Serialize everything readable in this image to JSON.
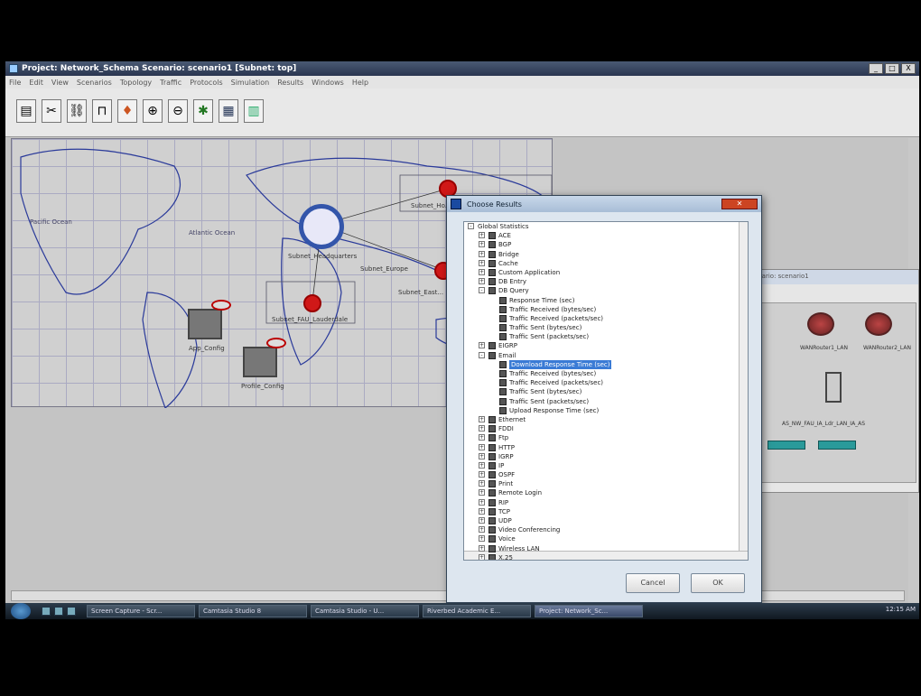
{
  "window": {
    "title": "Project: Network_Schema Scenario: scenario1 [Subnet: top]",
    "controls": [
      "_",
      "□",
      "X"
    ]
  },
  "menubar": [
    "File",
    "Edit",
    "View",
    "Scenarios",
    "Topology",
    "Traffic",
    "Protocols",
    "Simulation",
    "Results",
    "Windows",
    "Help"
  ],
  "toolbar": [
    "open-icon",
    "cut-tool-icon",
    "link-tool-icon",
    "subnet-tool-icon",
    "location-pin-icon",
    "zoom-in-icon",
    "zoom-out-icon",
    "configure-icon",
    "run-simulation-icon",
    "view-results-icon"
  ],
  "map": {
    "region_labels": [
      "Pacific Ocean",
      "Atlantic Ocean"
    ],
    "nodes": [
      {
        "label": "Subnet_Ho..."
      },
      {
        "label": "Subnet_East..."
      },
      {
        "label": "Subnet_FAU_Lauderdale"
      },
      {
        "label": "Subnet_Headquarters"
      },
      {
        "label": "Subnet_Europe"
      },
      {
        "label": "App_Config"
      },
      {
        "label": "Profile_Config"
      }
    ]
  },
  "subnet_window": {
    "title": "...ario: scenario1",
    "devices": [
      "WANRouter1_LAN",
      "WANRouter2_LAN",
      "AS_NW_FAU_IA_Ldr_LAN_IA_AS"
    ]
  },
  "dialog": {
    "title": "Choose Results",
    "tree": [
      {
        "label": "Global Statistics",
        "level": 0,
        "expander": "-",
        "checkbox": false
      },
      {
        "label": "ACE",
        "level": 1,
        "expander": "+",
        "checkbox": true
      },
      {
        "label": "BGP",
        "level": 1,
        "expander": "+",
        "checkbox": true
      },
      {
        "label": "Bridge",
        "level": 1,
        "expander": "+",
        "checkbox": true
      },
      {
        "label": "Cache",
        "level": 1,
        "expander": "+",
        "checkbox": true
      },
      {
        "label": "Custom Application",
        "level": 1,
        "expander": "+",
        "checkbox": true
      },
      {
        "label": "DB Entry",
        "level": 1,
        "expander": "+",
        "checkbox": true
      },
      {
        "label": "DB Query",
        "level": 1,
        "expander": "-",
        "checkbox": true
      },
      {
        "label": "Response Time (sec)",
        "level": 2,
        "expander": "",
        "checkbox": true
      },
      {
        "label": "Traffic Received (bytes/sec)",
        "level": 2,
        "expander": "",
        "checkbox": true
      },
      {
        "label": "Traffic Received (packets/sec)",
        "level": 2,
        "expander": "",
        "checkbox": true
      },
      {
        "label": "Traffic Sent (bytes/sec)",
        "level": 2,
        "expander": "",
        "checkbox": true
      },
      {
        "label": "Traffic Sent (packets/sec)",
        "level": 2,
        "expander": "",
        "checkbox": true
      },
      {
        "label": "EIGRP",
        "level": 1,
        "expander": "+",
        "checkbox": true
      },
      {
        "label": "Email",
        "level": 1,
        "expander": "-",
        "checkbox": true
      },
      {
        "label": "Download Response Time (sec)",
        "level": 2,
        "expander": "",
        "checkbox": true,
        "selected": true
      },
      {
        "label": "Traffic Received (bytes/sec)",
        "level": 2,
        "expander": "",
        "checkbox": true
      },
      {
        "label": "Traffic Received (packets/sec)",
        "level": 2,
        "expander": "",
        "checkbox": true
      },
      {
        "label": "Traffic Sent (bytes/sec)",
        "level": 2,
        "expander": "",
        "checkbox": true
      },
      {
        "label": "Traffic Sent (packets/sec)",
        "level": 2,
        "expander": "",
        "checkbox": true
      },
      {
        "label": "Upload Response Time (sec)",
        "level": 2,
        "expander": "",
        "checkbox": true
      },
      {
        "label": "Ethernet",
        "level": 1,
        "expander": "+",
        "checkbox": true
      },
      {
        "label": "FDDI",
        "level": 1,
        "expander": "+",
        "checkbox": true
      },
      {
        "label": "Ftp",
        "level": 1,
        "expander": "+",
        "checkbox": true
      },
      {
        "label": "HTTP",
        "level": 1,
        "expander": "+",
        "checkbox": true
      },
      {
        "label": "IGRP",
        "level": 1,
        "expander": "+",
        "checkbox": true
      },
      {
        "label": "IP",
        "level": 1,
        "expander": "+",
        "checkbox": true
      },
      {
        "label": "OSPF",
        "level": 1,
        "expander": "+",
        "checkbox": true
      },
      {
        "label": "Print",
        "level": 1,
        "expander": "+",
        "checkbox": true
      },
      {
        "label": "Remote Login",
        "level": 1,
        "expander": "+",
        "checkbox": true
      },
      {
        "label": "RIP",
        "level": 1,
        "expander": "+",
        "checkbox": true
      },
      {
        "label": "TCP",
        "level": 1,
        "expander": "+",
        "checkbox": true
      },
      {
        "label": "UDP",
        "level": 1,
        "expander": "+",
        "checkbox": true
      },
      {
        "label": "Video Conferencing",
        "level": 1,
        "expander": "+",
        "checkbox": true
      },
      {
        "label": "Voice",
        "level": 1,
        "expander": "+",
        "checkbox": true
      },
      {
        "label": "Wireless LAN",
        "level": 1,
        "expander": "+",
        "checkbox": true
      },
      {
        "label": "X.25",
        "level": 1,
        "expander": "+",
        "checkbox": true
      }
    ],
    "buttons": {
      "cancel": "Cancel",
      "ok": "OK"
    }
  },
  "taskbar": {
    "tasks": [
      {
        "label": "Screen Capture - Scr...",
        "active": false
      },
      {
        "label": "Camtasia Studio 8",
        "active": false
      },
      {
        "label": "Camtasia Studio - U...",
        "active": false
      },
      {
        "label": "Riverbed Academic E...",
        "active": false
      },
      {
        "label": "Project: Network_Sc...",
        "active": true
      }
    ],
    "clock": "12:15 AM"
  },
  "colors": {
    "selection": "#3a7bd5",
    "titlebar": "#2a3550",
    "node_red": "#d01818"
  }
}
